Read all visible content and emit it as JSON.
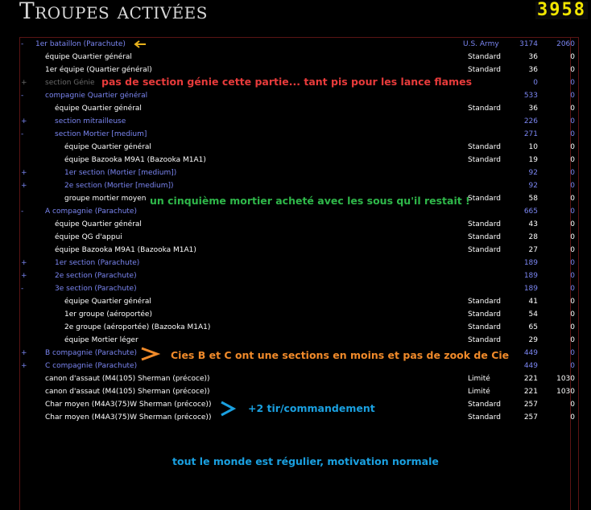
{
  "header": {
    "title": "Troupes activées",
    "counter": "3958"
  },
  "rows": [
    {
      "toggle": "-",
      "name": "1er bataillon (Parachute)",
      "quality": "U.S. Army",
      "v1": "3174",
      "v2": "2060",
      "indent": 0,
      "color": "blue"
    },
    {
      "toggle": "",
      "name": "équipe Quartier général",
      "quality": "Standard",
      "v1": "36",
      "v2": "0",
      "indent": 0,
      "color": "white"
    },
    {
      "toggle": "",
      "name": "1er équipe (Quartier général)",
      "quality": "Standard",
      "v1": "36",
      "v2": "0",
      "indent": 0,
      "color": "white"
    },
    {
      "toggle": "+",
      "name": "section Génie",
      "quality": "",
      "v1": "0",
      "v2": "0",
      "indent": 0,
      "color": "grey"
    },
    {
      "toggle": "-",
      "name": "compagnie Quartier général",
      "quality": "",
      "v1": "533",
      "v2": "0",
      "indent": 0,
      "color": "blue"
    },
    {
      "toggle": "",
      "name": "équipe Quartier général",
      "quality": "Standard",
      "v1": "36",
      "v2": "0",
      "indent": 1,
      "color": "white"
    },
    {
      "toggle": "+",
      "name": "section mitrailleuse",
      "quality": "",
      "v1": "226",
      "v2": "0",
      "indent": 1,
      "color": "blue"
    },
    {
      "toggle": "-",
      "name": "section Mortier [medium]",
      "quality": "",
      "v1": "271",
      "v2": "0",
      "indent": 1,
      "color": "blue"
    },
    {
      "toggle": "",
      "name": "équipe Quartier général",
      "quality": "Standard",
      "v1": "10",
      "v2": "0",
      "indent": 2,
      "color": "white"
    },
    {
      "toggle": "",
      "name": "équipe Bazooka M9A1 (Bazooka M1A1)",
      "quality": "Standard",
      "v1": "19",
      "v2": "0",
      "indent": 2,
      "color": "white"
    },
    {
      "toggle": "+",
      "name": "1er section (Mortier [medium])",
      "quality": "",
      "v1": "92",
      "v2": "0",
      "indent": 2,
      "color": "blue"
    },
    {
      "toggle": "+",
      "name": "2e section (Mortier [medium])",
      "quality": "",
      "v1": "92",
      "v2": "0",
      "indent": 2,
      "color": "blue"
    },
    {
      "toggle": "",
      "name": "groupe mortier moyen",
      "quality": "Standard",
      "v1": "58",
      "v2": "0",
      "indent": 2,
      "color": "white"
    },
    {
      "toggle": "-",
      "name": "A compagnie (Parachute)",
      "quality": "",
      "v1": "665",
      "v2": "0",
      "indent": 0,
      "color": "blue"
    },
    {
      "toggle": "",
      "name": "équipe Quartier général",
      "quality": "Standard",
      "v1": "43",
      "v2": "0",
      "indent": 1,
      "color": "white"
    },
    {
      "toggle": "",
      "name": "équipe QG d'appui",
      "quality": "Standard",
      "v1": "28",
      "v2": "0",
      "indent": 1,
      "color": "white"
    },
    {
      "toggle": "",
      "name": "équipe Bazooka M9A1 (Bazooka M1A1)",
      "quality": "Standard",
      "v1": "27",
      "v2": "0",
      "indent": 1,
      "color": "white"
    },
    {
      "toggle": "+",
      "name": "1er section (Parachute)",
      "quality": "",
      "v1": "189",
      "v2": "0",
      "indent": 1,
      "color": "blue"
    },
    {
      "toggle": "+",
      "name": "2e section (Parachute)",
      "quality": "",
      "v1": "189",
      "v2": "0",
      "indent": 1,
      "color": "blue"
    },
    {
      "toggle": "-",
      "name": "3e section (Parachute)",
      "quality": "",
      "v1": "189",
      "v2": "0",
      "indent": 1,
      "color": "blue"
    },
    {
      "toggle": "",
      "name": "équipe Quartier général",
      "quality": "Standard",
      "v1": "41",
      "v2": "0",
      "indent": 2,
      "color": "white"
    },
    {
      "toggle": "",
      "name": "1er groupe (aéroportée)",
      "quality": "Standard",
      "v1": "54",
      "v2": "0",
      "indent": 2,
      "color": "white"
    },
    {
      "toggle": "",
      "name": "2e groupe (aéroportée) (Bazooka M1A1)",
      "quality": "Standard",
      "v1": "65",
      "v2": "0",
      "indent": 2,
      "color": "white"
    },
    {
      "toggle": "",
      "name": "équipe Mortier léger",
      "quality": "Standard",
      "v1": "29",
      "v2": "0",
      "indent": 2,
      "color": "white"
    },
    {
      "toggle": "+",
      "name": "B compagnie (Parachute)",
      "quality": "",
      "v1": "449",
      "v2": "0",
      "indent": 0,
      "color": "blue"
    },
    {
      "toggle": "+",
      "name": "C compagnie (Parachute)",
      "quality": "",
      "v1": "449",
      "v2": "0",
      "indent": 0,
      "color": "blue"
    },
    {
      "toggle": "",
      "name": "canon d'assaut (M4(105) Sherman (précoce))",
      "quality": "Limité",
      "v1": "221",
      "v2": "1030",
      "indent": 0,
      "color": "white"
    },
    {
      "toggle": "",
      "name": "canon d'assaut (M4(105) Sherman (précoce))",
      "quality": "Limité",
      "v1": "221",
      "v2": "1030",
      "indent": 0,
      "color": "white"
    },
    {
      "toggle": "",
      "name": "Char moyen (M4A3(75)W Sherman (précoce))",
      "quality": "Standard",
      "v1": "257",
      "v2": "0",
      "indent": 0,
      "color": "white"
    },
    {
      "toggle": "",
      "name": "Char moyen (M4A3(75)W Sherman (précoce))",
      "quality": "Standard",
      "v1": "257",
      "v2": "0",
      "indent": 0,
      "color": "white"
    }
  ],
  "annotations": {
    "genie": "pas de section génie cette partie... tant pis pour les lance flames",
    "mortier": "un cinquième mortier acheté avec les sous qu'il restait !",
    "cies": "Cies B et C ont une sections en moins et pas de zook de Cie",
    "tir": "+2 tir/commandement",
    "regulier": "tout le monde est régulier, motivation normale"
  },
  "colors": {
    "blue": "#7b86f2",
    "white": "#ffffff",
    "grey": "#6a6a6a",
    "accent": "#f2e600"
  }
}
